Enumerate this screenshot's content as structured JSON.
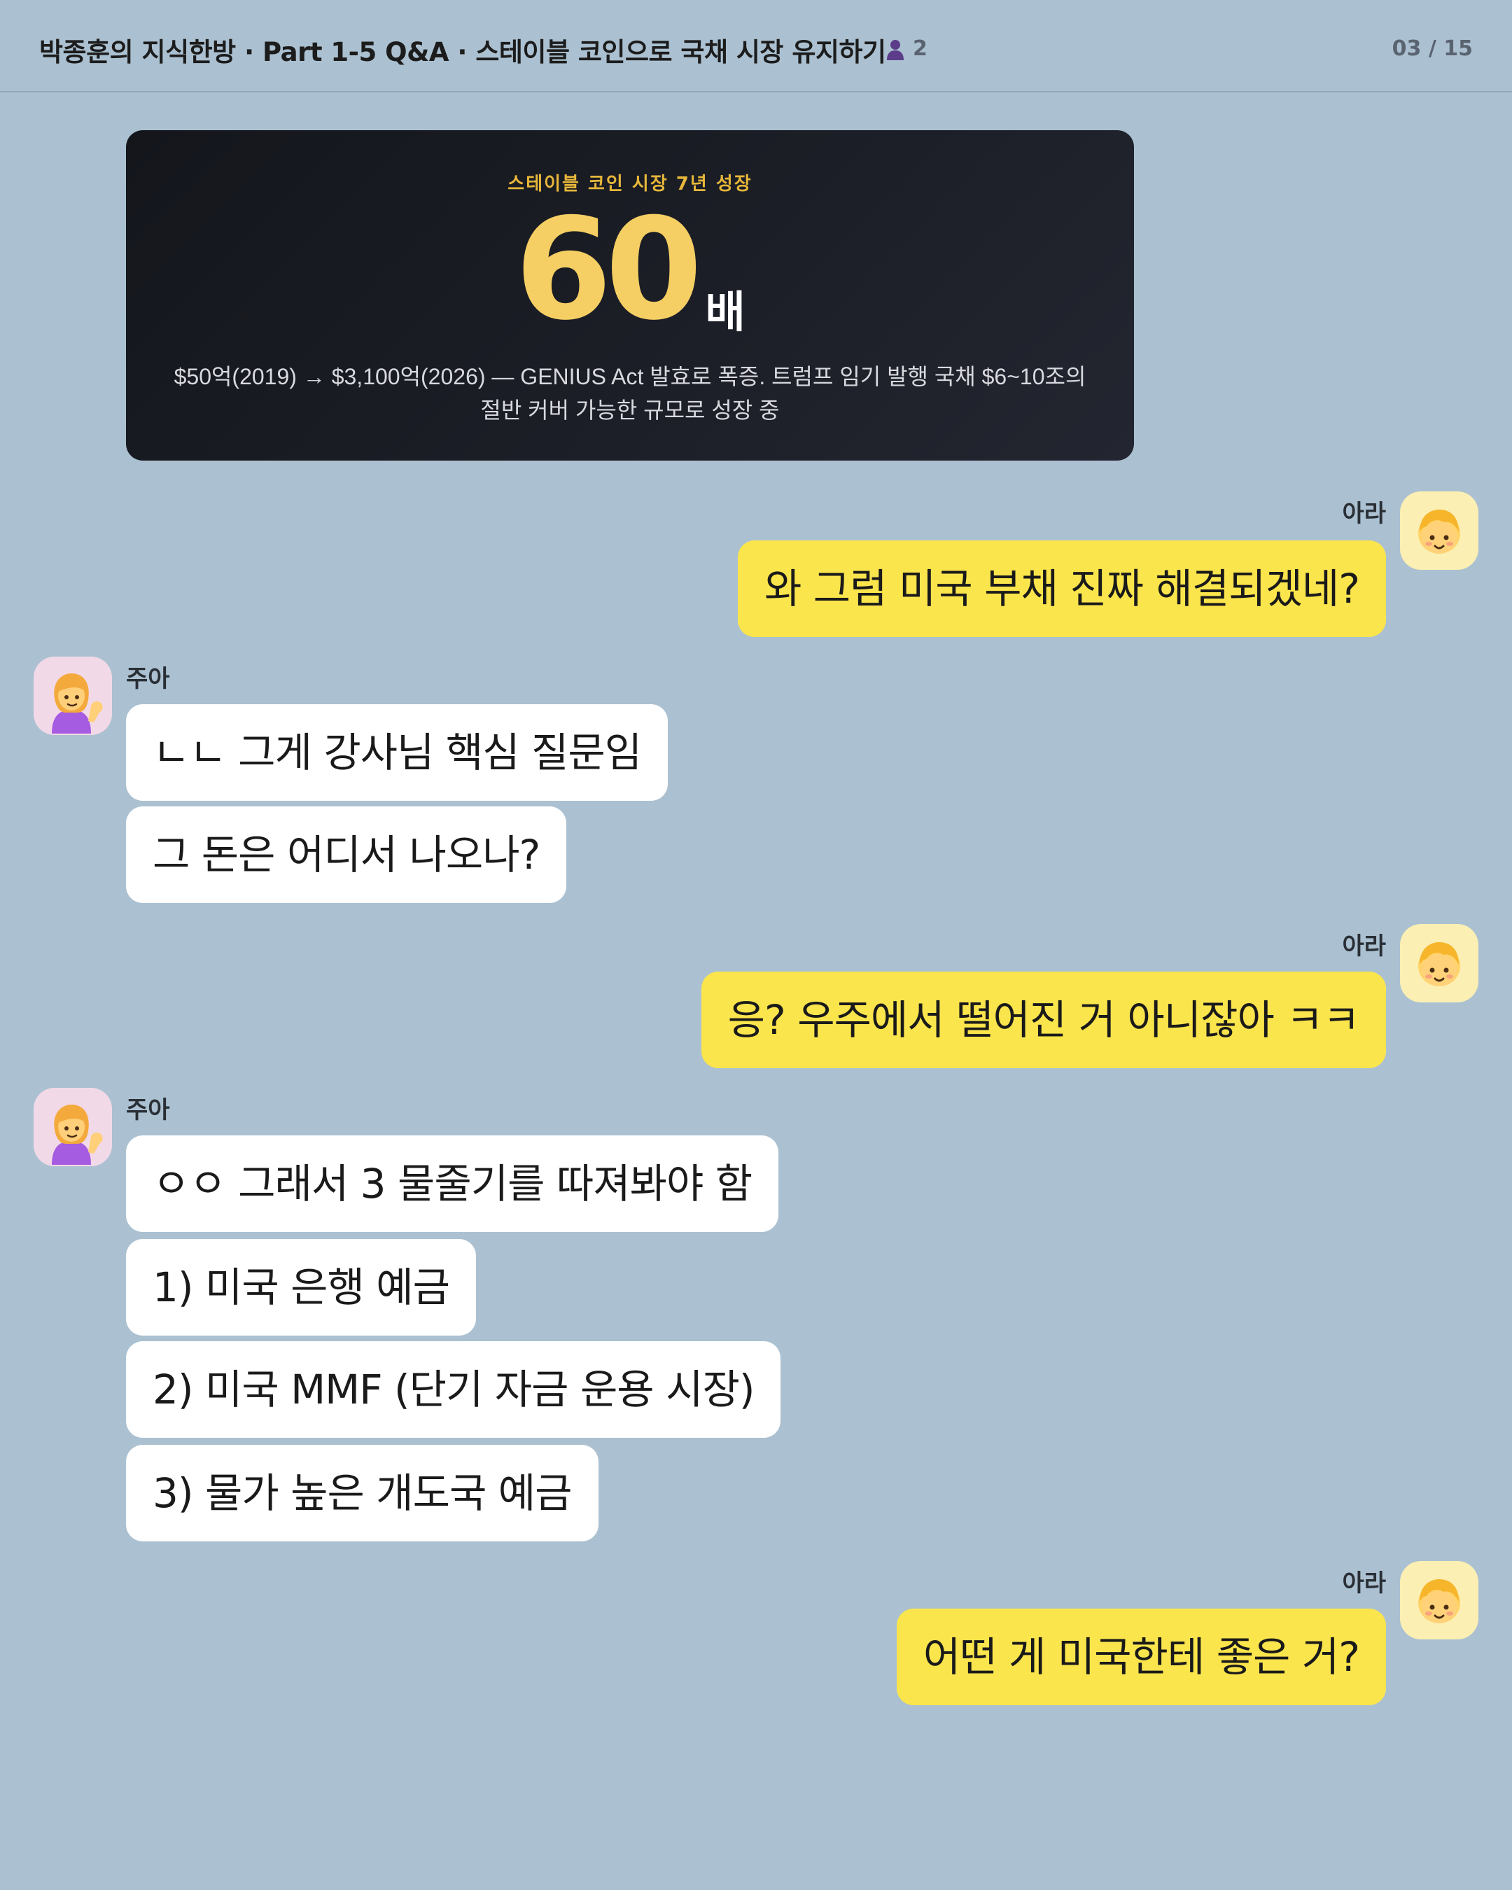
{
  "header": {
    "title": "박종훈의 지식한방 · Part 1-5 Q&A · 스테이블 코인으로 국채 시장 유지하기",
    "member_icon": "person-icon",
    "member_count": "2",
    "page_counter": "03 / 15"
  },
  "stat_card": {
    "kicker": "스테이블 코인 시장 7년 성장",
    "number": "60",
    "unit": "배",
    "description": "$50억(2019) → $3,100억(2026) — GENIUS Act 발효로 폭증. 트럼프 임기 발행 국채 $6~10조의 절반 커버 가능한 규모로 성장 중",
    "colors": {
      "number": "#f5cf63",
      "kicker": "#e6b73a",
      "background": "#1b1d24"
    }
  },
  "participants": {
    "ara": {
      "name": "아라",
      "avatar_icon": "blonde-child-emoji-icon",
      "avatar_bg": "#fbefb3"
    },
    "jua": {
      "name": "주아",
      "avatar_icon": "tipping-hand-woman-emoji-icon",
      "avatar_bg": "#f2d9e8"
    }
  },
  "messages": [
    {
      "sender": "아라",
      "text": "와 그럼 미국 부채 진짜 해결되겠네?"
    },
    {
      "sender": "주아",
      "text": "ㄴㄴ 그게 강사님 핵심 질문임"
    },
    {
      "sender": "주아",
      "text": "그 돈은 어디서 나오나?"
    },
    {
      "sender": "아라",
      "text": "응? 우주에서 떨어진 거 아니잖아 ㅋㅋ"
    },
    {
      "sender": "주아",
      "text": "ㅇㅇ 그래서 3 물줄기를 따져봐야 함"
    },
    {
      "sender": "주아",
      "text": "1) 미국 은행 예금"
    },
    {
      "sender": "주아",
      "text": "2) 미국 MMF (단기 자금 운용 시장)"
    },
    {
      "sender": "주아",
      "text": "3) 물가 높은 개도국 예금"
    },
    {
      "sender": "아라",
      "text": "어떤 게 미국한테 좋은 거?"
    }
  ],
  "colors": {
    "chat_background": "#abc1d1",
    "my_bubble": "#fbe54c",
    "their_bubble": "#ffffff"
  }
}
